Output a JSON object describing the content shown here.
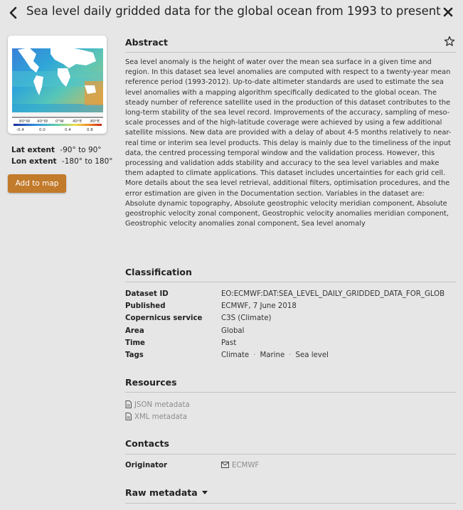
{
  "header": {
    "title": "Sea level daily gridded data for the global ocean from 1993 to present",
    "back_icon": "chevron-left-icon",
    "close_icon": "close-icon"
  },
  "thumbnail": {
    "longitude_labels": [
      "80°W",
      "40°W",
      "0°W",
      "40°E",
      "80°E"
    ],
    "colorbar_labels": [
      "-0.4",
      "0.0",
      "0.4",
      "0.8"
    ]
  },
  "extent": {
    "lat_label": "Lat extent",
    "lat_value": "-90° to 90°",
    "lon_label": "Lon extent",
    "lon_value": "-180° to 180°"
  },
  "add_to_map_label": "Add to map",
  "abstract": {
    "heading": "Abstract",
    "favorite_icon": "star-icon",
    "text": "Sea level anomaly is the height of water over the mean sea surface in a given time and region. In this dataset sea level anomalies are computed with respect to a twenty-year mean reference period (1993-2012). Up-to-date altimeter standards are used to estimate the sea level anomalies with a mapping algorithm specifically dedicated to the global ocean. The steady number of reference satellite used in the production of this dataset contributes to the long-term stability of the sea level record. Improvements of the accuracy, sampling of meso-scale processes and of the high-latitude coverage were achieved by using a few additional satellite missions. New data are provided with a delay of about 4-5 months relatively to near-real time or interim sea level products. This delay is mainly due to the timeliness of the input data, the centred processing temporal window and the validation process. However, this processing and validation adds stability and accuracy to the sea level variables and make them adapted to climate applications. This dataset includes uncertainties for each grid cell. More details about the sea level retrieval, additional filters, optimisation procedures, and the error estimation are given in the Documentation section. Variables in the dataset are: Absolute dynamic topography, Absolute geostrophic velocity meridian component, Absolute geostrophic velocity zonal component, Geostrophic velocity anomalies meridian component, Geostrophic velocity anomalies zonal component, Sea level anomaly"
  },
  "classification": {
    "heading": "Classification",
    "rows": [
      {
        "key": "Dataset ID",
        "value": "EO:ECMWF:DAT:SEA_LEVEL_DAILY_GRIDDED_DATA_FOR_GLOB"
      },
      {
        "key": "Published",
        "value": "ECMWF, 7 June 2018"
      },
      {
        "key": "Copernicus service",
        "value": "C3S (Climate)"
      },
      {
        "key": "Area",
        "value": "Global"
      },
      {
        "key": "Time",
        "value": "Past"
      }
    ],
    "tags_label": "Tags",
    "tags": [
      "Climate",
      "Marine",
      "Sea level"
    ]
  },
  "resources": {
    "heading": "Resources",
    "items": [
      {
        "label": "JSON metadata",
        "icon": "file-icon"
      },
      {
        "label": "XML metadata",
        "icon": "file-icon"
      }
    ]
  },
  "contacts": {
    "heading": "Contacts",
    "originator_label": "Originator",
    "originator_value": "ECMWF",
    "originator_icon": "mail-icon"
  },
  "raw_metadata": {
    "heading": "Raw metadata",
    "toggle_icon": "caret-down-icon"
  }
}
